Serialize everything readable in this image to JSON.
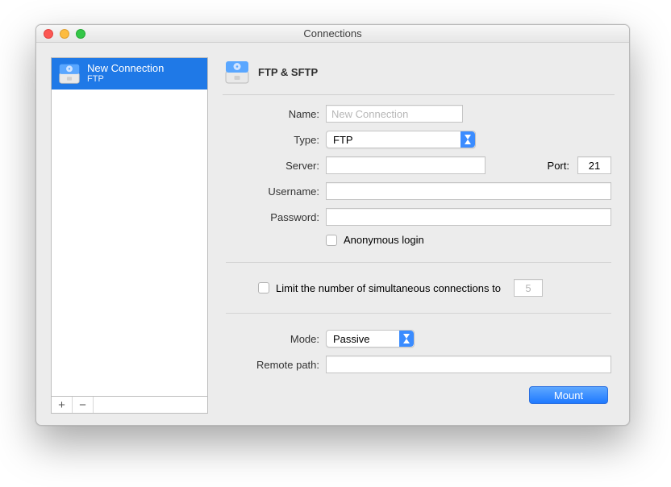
{
  "window": {
    "title": "Connections"
  },
  "sidebar": {
    "items": [
      {
        "title": "New Connection",
        "subtitle": "FTP"
      }
    ],
    "add_label": "+",
    "remove_label": "−"
  },
  "panel": {
    "title": "FTP & SFTP",
    "labels": {
      "name": "Name:",
      "type": "Type:",
      "server": "Server:",
      "port": "Port:",
      "username": "Username:",
      "password": "Password:",
      "anonymous": "Anonymous login",
      "limit": "Limit the number of simultaneous connections to",
      "mode": "Mode:",
      "remote_path": "Remote path:"
    },
    "values": {
      "name_placeholder": "New Connection",
      "type": "FTP",
      "server": "",
      "port": "21",
      "username": "",
      "password": "",
      "anonymous": false,
      "limit_enabled": false,
      "limit_value": "5",
      "mode": "Passive",
      "remote_path": ""
    },
    "mount_button": "Mount"
  }
}
